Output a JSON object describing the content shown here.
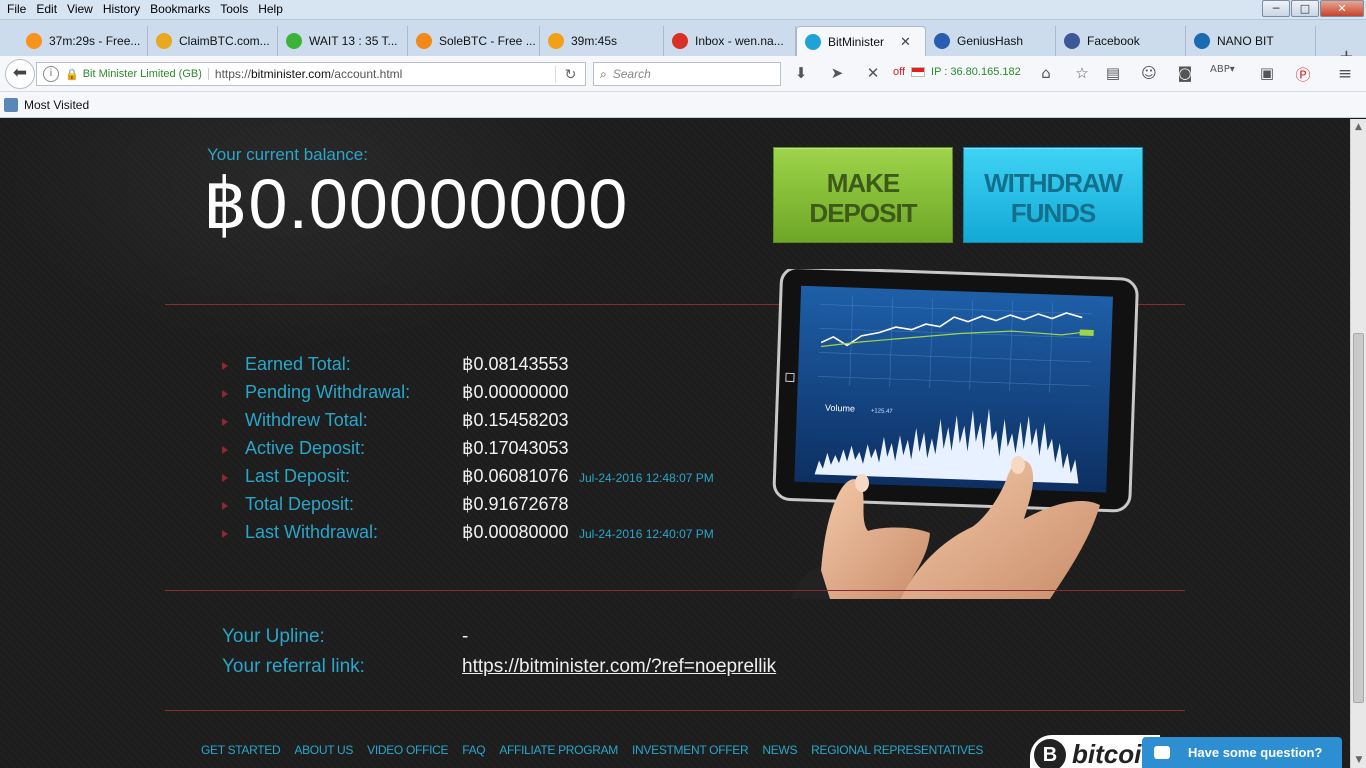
{
  "menu": [
    "File",
    "Edit",
    "View",
    "History",
    "Bookmarks",
    "Tools",
    "Help"
  ],
  "window_controls": {
    "minimize": "─",
    "maximize": "□",
    "close": "✕"
  },
  "tabs": [
    {
      "label": "37m:29s - Free...",
      "icon_color": "#f7931a",
      "icon": "bitcoin-icon"
    },
    {
      "label": "ClaimBTC.com...",
      "icon_color": "#e8a820",
      "icon": "bitcoin-icon"
    },
    {
      "label": "WAIT 13 : 35 T...",
      "icon_color": "#3bb33b",
      "icon": "smiley-icon"
    },
    {
      "label": "SoleBTC - Free ...",
      "icon_color": "#f28a1a",
      "icon": "bitcoin-icon"
    },
    {
      "label": "39m:45s",
      "icon_color": "#f2a01a",
      "icon": "bitcoin-icon"
    },
    {
      "label": "Inbox - wen.na...",
      "icon_color": "#d93025",
      "icon": "gmail-icon"
    },
    {
      "label": "BitMinister",
      "icon_color": "#1fa3d6",
      "icon": "bitminister-icon",
      "active": true
    },
    {
      "label": "GeniusHash",
      "icon_color": "#2a5db0",
      "icon": "hash-icon"
    },
    {
      "label": "Facebook",
      "icon_color": "#3b5998",
      "icon": "facebook-icon"
    },
    {
      "label": "NANO BIT",
      "icon_color": "#1a6bb0",
      "icon": "nano-icon"
    }
  ],
  "urlbar": {
    "site_identity": "Bit Minister Limited (GB)",
    "url_prefix": "https://",
    "url_host": "bitminister.com",
    "url_path": "/account.html"
  },
  "search": {
    "placeholder": "Search"
  },
  "ip_widget": {
    "status": "off",
    "text": "IP : 36.80.165.182"
  },
  "bookmarks": {
    "most_visited": "Most Visited"
  },
  "balance": {
    "label": "Your current balance:",
    "value": "฿0.00000000"
  },
  "buttons": {
    "deposit_line1": "MAKE",
    "deposit_line2": "DEPOSIT",
    "withdraw_line1": "WITHDRAW",
    "withdraw_line2": "FUNDS"
  },
  "stats": [
    {
      "label": "Earned Total:",
      "value": "฿0.08143553",
      "time": ""
    },
    {
      "label": "Pending Withdrawal:",
      "value": "฿0.00000000",
      "time": ""
    },
    {
      "label": "Withdrew Total:",
      "value": "฿0.15458203",
      "time": ""
    },
    {
      "label": "Active Deposit:",
      "value": "฿0.17043053",
      "time": ""
    },
    {
      "label": "Last Deposit:",
      "value": "฿0.06081076",
      "time": "Jul-24-2016 12:48:07 PM"
    },
    {
      "label": "Total Deposit:",
      "value": "฿0.91672678",
      "time": ""
    },
    {
      "label": "Last Withdrawal:",
      "value": "฿0.00080000",
      "time": "Jul-24-2016 12:40:07 PM"
    }
  ],
  "referral": {
    "upline_label": "Your Upline:",
    "upline_value": "-",
    "link_label": "Your referral link:",
    "link_value": "https://bitminister.com/?ref=noeprellik"
  },
  "tablet": {
    "volume_label": "Volume",
    "volume_value": "+125.47"
  },
  "footer": [
    "GET STARTED",
    "ABOUT US",
    "VIDEO OFFICE",
    "FAQ",
    "AFFILIATE PROGRAM",
    "INVESTMENT OFFER",
    "NEWS",
    "REGIONAL REPRESENTATIVES"
  ],
  "bitcoin_logo": {
    "symbol": "B",
    "text": "bitcoin"
  },
  "chat": {
    "label": "Have some question?"
  },
  "colors": {
    "accent_blue": "#2aa6c9",
    "deposit_green": "#8cc63f",
    "withdraw_cyan": "#29c5ef",
    "divider": "#8a2a33"
  }
}
